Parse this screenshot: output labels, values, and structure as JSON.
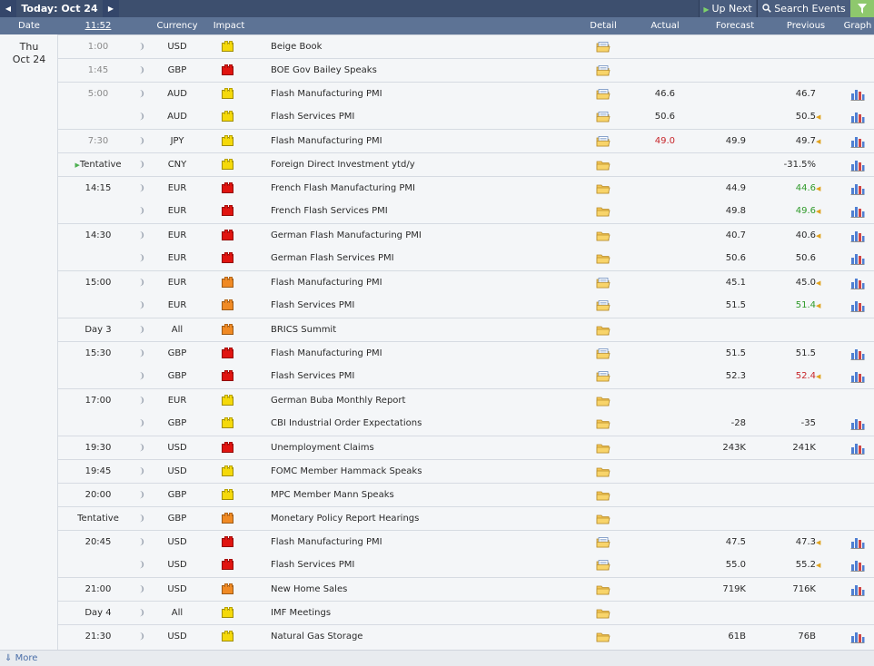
{
  "topbar": {
    "today_label": "Today: Oct 24",
    "up_next_label": "Up Next",
    "search_label": "Search Events"
  },
  "header": {
    "date": "Date",
    "time": "11:52",
    "currency": "Currency",
    "impact": "Impact",
    "detail": "Detail",
    "actual": "Actual",
    "forecast": "Forecast",
    "previous": "Previous",
    "graph": "Graph"
  },
  "date": {
    "day": "Thu",
    "month_day": "Oct 24"
  },
  "colors": {
    "impact_low": "#f5d90a",
    "impact_medium": "#f08a24",
    "impact_high": "#e01410",
    "better": "#2f9a2a",
    "worse": "#c7262b"
  },
  "events": [
    {
      "time": "1:00",
      "muted": true,
      "group_start": true,
      "currency": "USD",
      "impact": "low",
      "event": "Beige Book",
      "detail": "open-folder-icon",
      "actual": "",
      "forecast": "",
      "previous": "",
      "graph": false
    },
    {
      "time": "1:45",
      "muted": true,
      "group_start": true,
      "currency": "GBP",
      "impact": "high",
      "event": "BOE Gov Bailey Speaks",
      "detail": "open-folder-icon",
      "actual": "",
      "forecast": "",
      "previous": "",
      "graph": false
    },
    {
      "time": "5:00",
      "muted": true,
      "group_start": true,
      "currency": "AUD",
      "impact": "low",
      "event": "Flash Manufacturing PMI",
      "detail": "open-folder-icon",
      "actual": "46.6",
      "forecast": "",
      "previous": "46.7",
      "graph": true
    },
    {
      "time": "",
      "currency": "AUD",
      "impact": "low",
      "event": "Flash Services PMI",
      "detail": "open-folder-icon",
      "actual": "50.6",
      "forecast": "",
      "previous": "50.5",
      "revised": true,
      "graph": true
    },
    {
      "time": "7:30",
      "muted": true,
      "group_start": true,
      "currency": "JPY",
      "impact": "low",
      "event": "Flash Manufacturing PMI",
      "detail": "open-folder-icon",
      "actual": "49.0",
      "actual_color": "red",
      "forecast": "49.9",
      "previous": "49.7",
      "revised": true,
      "graph": true
    },
    {
      "time": "Tentative",
      "tentative_icon": true,
      "group_start": true,
      "currency": "CNY",
      "impact": "low",
      "event": "Foreign Direct Investment ytd/y",
      "detail": "folder-icon",
      "actual": "",
      "forecast": "",
      "previous": "-31.5%",
      "graph": true
    },
    {
      "time": "14:15",
      "group_start": true,
      "currency": "EUR",
      "impact": "high",
      "event": "French Flash Manufacturing PMI",
      "detail": "folder-icon",
      "actual": "",
      "forecast": "44.9",
      "previous": "44.6",
      "prev_color": "green",
      "revised": true,
      "graph": true
    },
    {
      "time": "",
      "currency": "EUR",
      "impact": "high",
      "event": "French Flash Services PMI",
      "detail": "folder-icon",
      "actual": "",
      "forecast": "49.8",
      "previous": "49.6",
      "prev_color": "green",
      "revised": true,
      "graph": true
    },
    {
      "time": "14:30",
      "group_start": true,
      "currency": "EUR",
      "impact": "high",
      "event": "German Flash Manufacturing PMI",
      "detail": "folder-icon",
      "actual": "",
      "forecast": "40.7",
      "previous": "40.6",
      "revised": true,
      "graph": true
    },
    {
      "time": "",
      "currency": "EUR",
      "impact": "high",
      "event": "German Flash Services PMI",
      "detail": "folder-icon",
      "actual": "",
      "forecast": "50.6",
      "previous": "50.6",
      "graph": true
    },
    {
      "time": "15:00",
      "group_start": true,
      "currency": "EUR",
      "impact": "medium",
      "event": "Flash Manufacturing PMI",
      "detail": "open-folder-icon",
      "actual": "",
      "forecast": "45.1",
      "previous": "45.0",
      "revised": true,
      "graph": true
    },
    {
      "time": "",
      "currency": "EUR",
      "impact": "medium",
      "event": "Flash Services PMI",
      "detail": "open-folder-icon",
      "actual": "",
      "forecast": "51.5",
      "previous": "51.4",
      "prev_color": "green",
      "revised": true,
      "graph": true
    },
    {
      "time": "Day 3",
      "group_start": true,
      "currency": "All",
      "impact": "medium",
      "event": "BRICS Summit",
      "detail": "folder-icon",
      "actual": "",
      "forecast": "",
      "previous": "",
      "graph": false
    },
    {
      "time": "15:30",
      "group_start": true,
      "currency": "GBP",
      "impact": "high",
      "event": "Flash Manufacturing PMI",
      "detail": "open-folder-icon",
      "actual": "",
      "forecast": "51.5",
      "previous": "51.5",
      "graph": true
    },
    {
      "time": "",
      "currency": "GBP",
      "impact": "high",
      "event": "Flash Services PMI",
      "detail": "open-folder-icon",
      "actual": "",
      "forecast": "52.3",
      "previous": "52.4",
      "prev_color": "red",
      "revised": true,
      "graph": true
    },
    {
      "time": "17:00",
      "group_start": true,
      "currency": "EUR",
      "impact": "low",
      "event": "German Buba Monthly Report",
      "detail": "folder-icon",
      "actual": "",
      "forecast": "",
      "previous": "",
      "graph": false
    },
    {
      "time": "",
      "currency": "GBP",
      "impact": "low",
      "event": "CBI Industrial Order Expectations",
      "detail": "folder-icon",
      "actual": "",
      "forecast": "-28",
      "previous": "-35",
      "graph": true
    },
    {
      "time": "19:30",
      "group_start": true,
      "currency": "USD",
      "impact": "high",
      "event": "Unemployment Claims",
      "detail": "folder-icon",
      "actual": "",
      "forecast": "243K",
      "previous": "241K",
      "graph": true
    },
    {
      "time": "19:45",
      "group_start": true,
      "currency": "USD",
      "impact": "low",
      "event": "FOMC Member Hammack Speaks",
      "detail": "folder-icon",
      "actual": "",
      "forecast": "",
      "previous": "",
      "graph": false
    },
    {
      "time": "20:00",
      "group_start": true,
      "currency": "GBP",
      "impact": "low",
      "event": "MPC Member Mann Speaks",
      "detail": "folder-icon",
      "actual": "",
      "forecast": "",
      "previous": "",
      "graph": false
    },
    {
      "time": "Tentative",
      "group_start": true,
      "currency": "GBP",
      "impact": "medium",
      "event": "Monetary Policy Report Hearings",
      "detail": "folder-icon",
      "actual": "",
      "forecast": "",
      "previous": "",
      "graph": false
    },
    {
      "time": "20:45",
      "group_start": true,
      "currency": "USD",
      "impact": "high",
      "event": "Flash Manufacturing PMI",
      "detail": "open-folder-icon",
      "actual": "",
      "forecast": "47.5",
      "previous": "47.3",
      "revised": true,
      "graph": true
    },
    {
      "time": "",
      "currency": "USD",
      "impact": "high",
      "event": "Flash Services PMI",
      "detail": "open-folder-icon",
      "actual": "",
      "forecast": "55.0",
      "previous": "55.2",
      "revised": true,
      "graph": true
    },
    {
      "time": "21:00",
      "group_start": true,
      "currency": "USD",
      "impact": "medium",
      "event": "New Home Sales",
      "detail": "folder-icon",
      "actual": "",
      "forecast": "719K",
      "previous": "716K",
      "graph": true
    },
    {
      "time": "Day 4",
      "group_start": true,
      "currency": "All",
      "impact": "low",
      "event": "IMF Meetings",
      "detail": "folder-icon",
      "actual": "",
      "forecast": "",
      "previous": "",
      "graph": false
    },
    {
      "time": "21:30",
      "group_start": true,
      "currency": "USD",
      "impact": "low",
      "event": "Natural Gas Storage",
      "detail": "folder-icon",
      "actual": "",
      "forecast": "61B",
      "previous": "76B",
      "graph": true
    }
  ],
  "footer": {
    "more_label": "More"
  }
}
